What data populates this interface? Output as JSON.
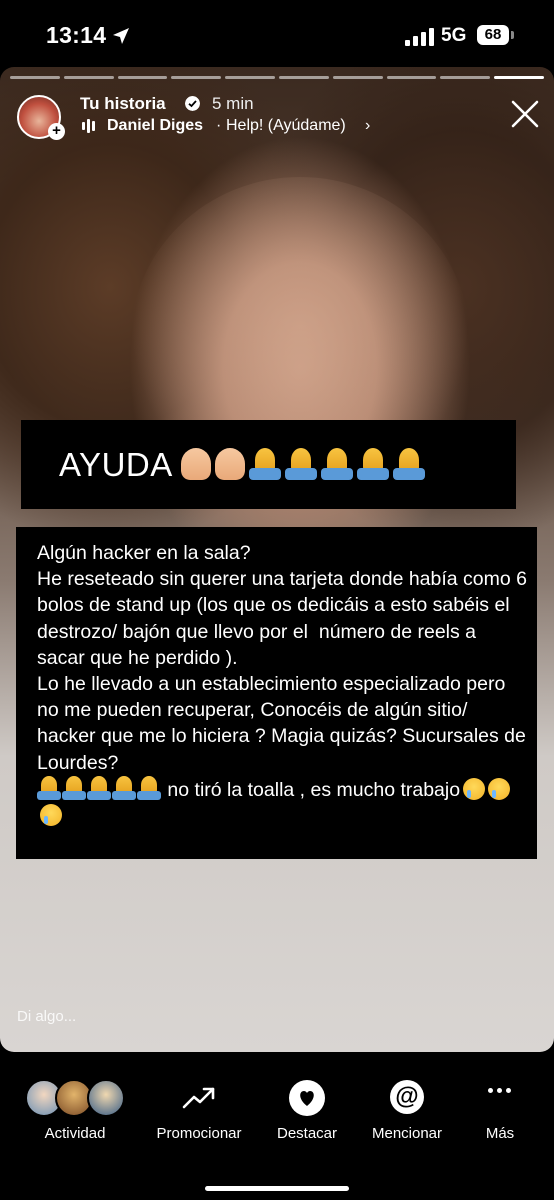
{
  "status_bar": {
    "time": "13:14",
    "network": "5G",
    "battery": "68"
  },
  "story": {
    "title": "Tu historia",
    "time_ago": "5 min",
    "music": {
      "artist": "Daniel Diges",
      "separator": "·",
      "song": "Help! (Ayúdame)",
      "chevron": "›"
    },
    "progress_segments": 10,
    "active_segment": 10
  },
  "stickers": {
    "heading": "AYUDA",
    "body": "Algún hacker en la sala?\nHe reseteado sin querer una tarjeta donde había como 6 bolos de stand up (los que os dedicáis a esto sabéis el destrozo/ bajón que llevo por el  número de reels a sacar que he perdido ).\nLo he llevado a un establecimiento especializado pero no me pueden recuperar, Conocéis de algún sitio/ hacker que me lo hiciera ? Magia quizás? Sucursales de Lourdes?",
    "tail_text": " no tiró la toalla , es mucho trabajo"
  },
  "reply_placeholder": "Di algo...",
  "bottom_bar": {
    "items": [
      {
        "label": "Actividad",
        "icon": "viewers-avatars-icon"
      },
      {
        "label": "Promocionar",
        "icon": "trend-up-icon"
      },
      {
        "label": "Destacar",
        "icon": "heart-circle-icon"
      },
      {
        "label": "Mencionar",
        "icon": "at-sign-icon"
      },
      {
        "label": "Más",
        "icon": "more-dots-icon"
      }
    ],
    "at_glyph": "@"
  },
  "colors": {
    "background": "#000000",
    "text": "#ffffff",
    "pray_blue": "#5a9ad8",
    "pray_yellow": "#f8c441"
  }
}
